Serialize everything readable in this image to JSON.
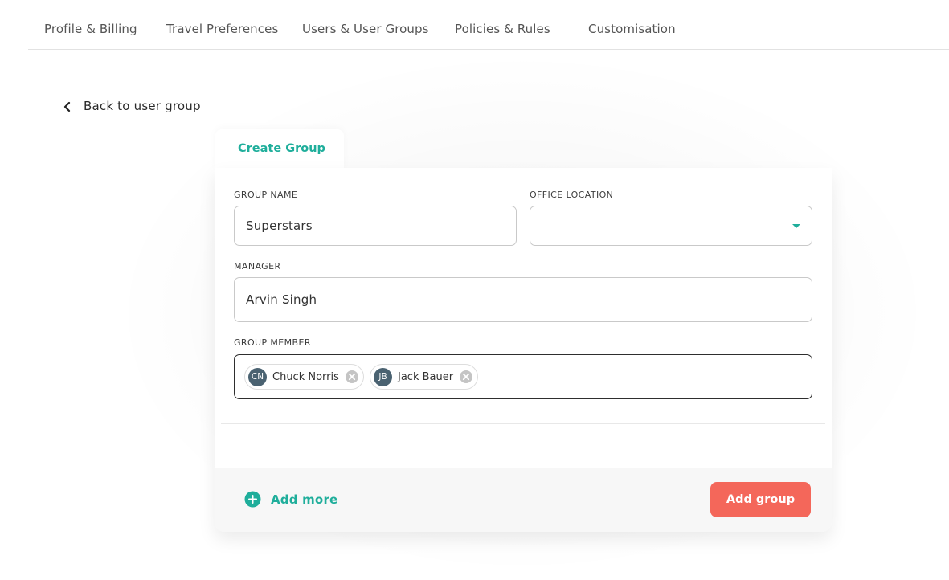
{
  "nav": {
    "tabs": [
      {
        "label": "Profile & Billing"
      },
      {
        "label": "Travel Preferences"
      },
      {
        "label": "Users & User Groups"
      },
      {
        "label": "Policies & Rules"
      },
      {
        "label": "Customisation"
      }
    ]
  },
  "back_link": {
    "label": "Back to user group",
    "icon": "chevron-left-icon"
  },
  "card": {
    "tab_label": "Create Group",
    "group_name": {
      "label": "GROUP NAME",
      "value": "Superstars"
    },
    "office_location": {
      "label": "OFFICE LOCATION",
      "value": ""
    },
    "manager": {
      "label": "MANAGER",
      "value": "Arvin Singh"
    },
    "group_member": {
      "label": "GROUP MEMBER",
      "members": [
        {
          "initials": "CN",
          "name": "Chuck Norris"
        },
        {
          "initials": "JB",
          "name": "Jack Bauer"
        }
      ]
    },
    "footer": {
      "add_more_label": "Add more",
      "add_group_label": "Add group"
    }
  },
  "colors": {
    "accent": "#1fae9b",
    "primary_button": "#f4675a",
    "avatar": "#4a6271"
  }
}
